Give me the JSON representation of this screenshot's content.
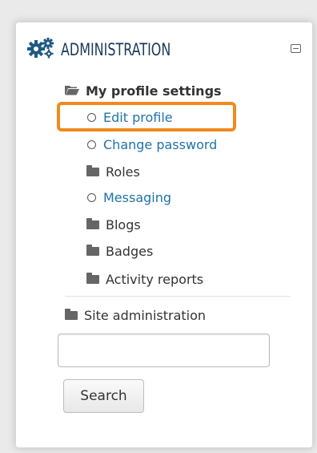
{
  "block": {
    "title": "ADMINISTRATION",
    "gears_icon": "gears-icon",
    "collapse_icon": "collapse-icon"
  },
  "tree": {
    "profile_settings": "My profile settings",
    "items": [
      {
        "label": "Edit profile",
        "icon": "circle-icon",
        "type": "link"
      },
      {
        "label": "Change password",
        "icon": "circle-icon",
        "type": "link"
      },
      {
        "label": "Roles",
        "icon": "folder-icon",
        "type": "folder"
      },
      {
        "label": "Messaging",
        "icon": "circle-icon",
        "type": "link"
      },
      {
        "label": "Blogs",
        "icon": "folder-icon",
        "type": "folder"
      },
      {
        "label": "Badges",
        "icon": "folder-icon",
        "type": "folder"
      },
      {
        "label": "Activity reports",
        "icon": "folder-icon",
        "type": "folder"
      }
    ],
    "site_admin": "Site administration"
  },
  "search": {
    "placeholder": "",
    "button_label": "Search"
  },
  "colors": {
    "link": "#1f73a8",
    "highlight": "#f08a1c",
    "title": "#1a3a5a"
  }
}
